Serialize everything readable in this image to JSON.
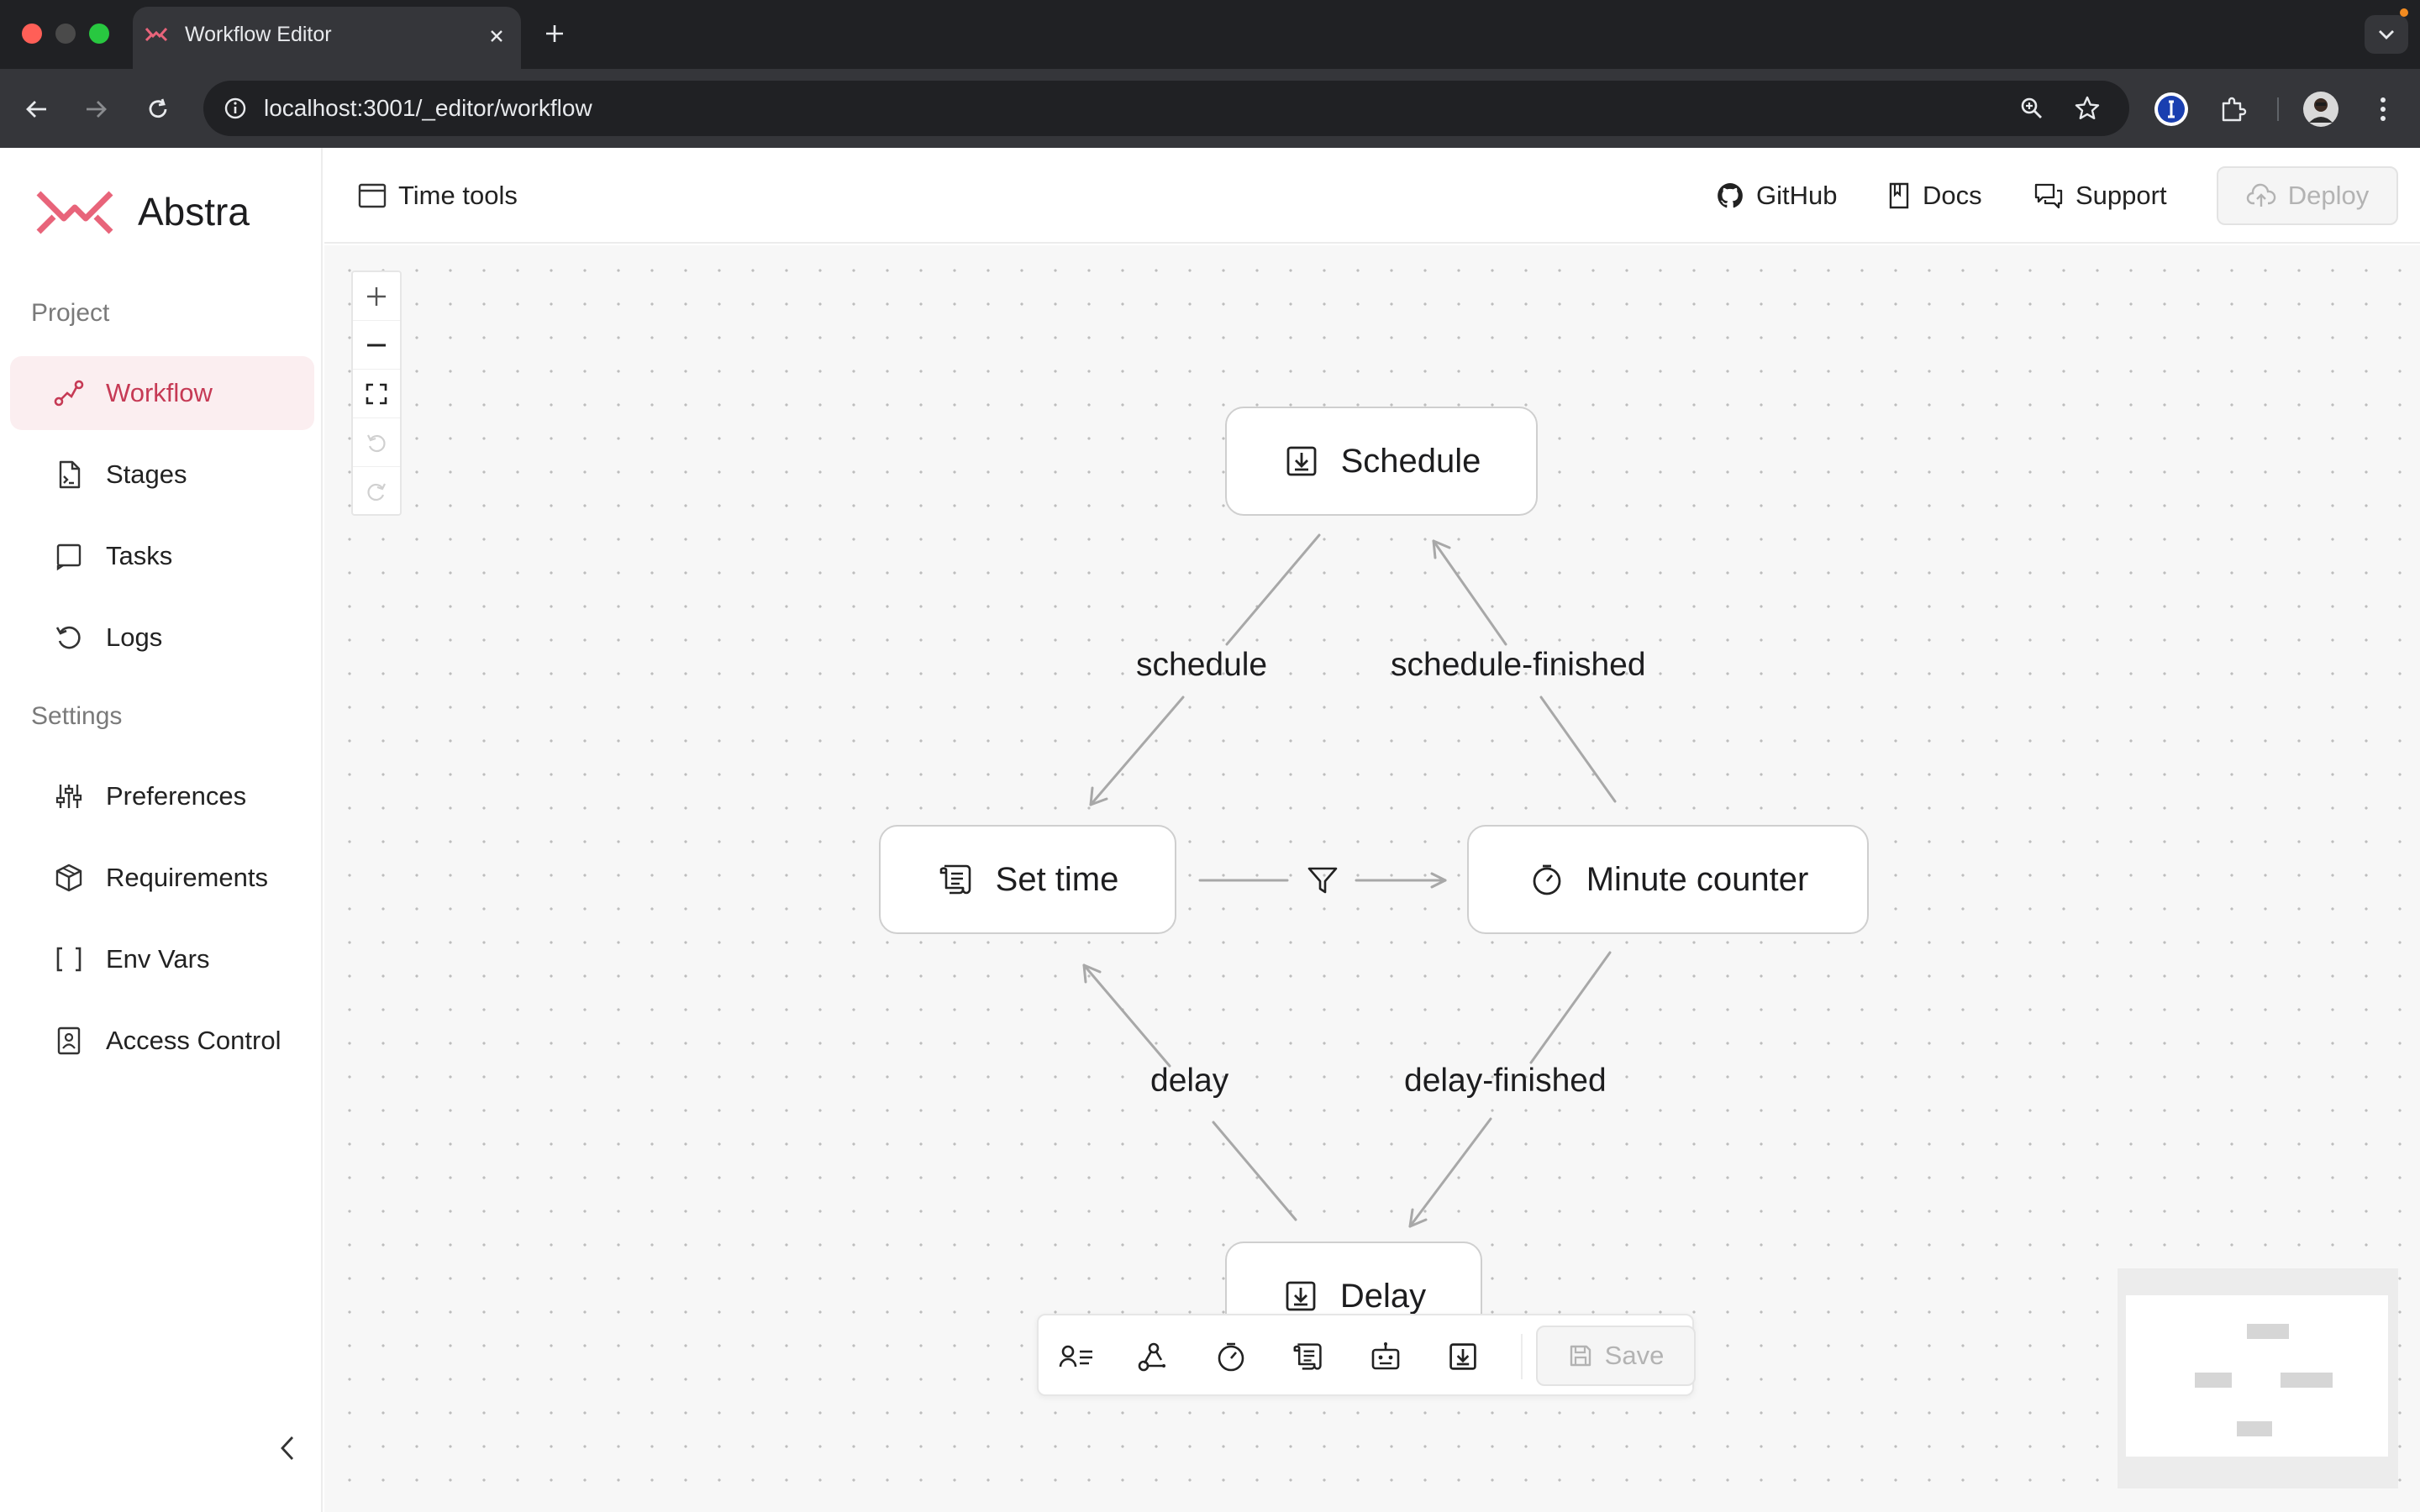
{
  "browser": {
    "tab_title": "Workflow Editor",
    "url": "localhost:3001/_editor/workflow"
  },
  "app": {
    "brand": "Abstra",
    "brand_color": "#e8647a",
    "accent_color": "#c63a55",
    "project_name": "Time tools"
  },
  "sidebar": {
    "sections": [
      {
        "label": "Project",
        "items": [
          {
            "label": "Workflow",
            "icon": "workflow-icon",
            "active": true
          },
          {
            "label": "Stages",
            "icon": "stages-icon"
          },
          {
            "label": "Tasks",
            "icon": "tasks-icon"
          },
          {
            "label": "Logs",
            "icon": "logs-icon"
          }
        ]
      },
      {
        "label": "Settings",
        "items": [
          {
            "label": "Preferences",
            "icon": "preferences-icon"
          },
          {
            "label": "Requirements",
            "icon": "requirements-icon"
          },
          {
            "label": "Env Vars",
            "icon": "env-vars-icon"
          },
          {
            "label": "Access Control",
            "icon": "access-control-icon"
          }
        ]
      }
    ]
  },
  "header": {
    "links": [
      {
        "label": "GitHub",
        "icon": "github-icon"
      },
      {
        "label": "Docs",
        "icon": "docs-icon"
      },
      {
        "label": "Support",
        "icon": "support-icon"
      }
    ],
    "deploy_label": "Deploy"
  },
  "workflow": {
    "nodes": [
      {
        "id": "schedule",
        "label": "Schedule",
        "icon": "job-icon"
      },
      {
        "id": "set-time",
        "label": "Set time",
        "icon": "script-icon"
      },
      {
        "id": "minute-counter",
        "label": "Minute counter",
        "icon": "timer-icon"
      },
      {
        "id": "delay",
        "label": "Delay",
        "icon": "job-icon"
      }
    ],
    "edges": [
      {
        "label": "schedule",
        "from": "schedule",
        "to": "set-time"
      },
      {
        "label": "schedule-finished",
        "from": "minute-counter",
        "to": "schedule"
      },
      {
        "label": "delay",
        "from": "delay",
        "to": "set-time"
      },
      {
        "label": "delay-finished",
        "from": "minute-counter",
        "to": "delay"
      },
      {
        "label": "",
        "from": "set-time",
        "to": "minute-counter",
        "icon": "filter-icon"
      }
    ]
  },
  "bottom_toolbar": {
    "tools": [
      "form-icon",
      "hook-icon",
      "timer-icon",
      "script-icon",
      "bot-icon",
      "job-icon"
    ],
    "save_label": "Save"
  }
}
